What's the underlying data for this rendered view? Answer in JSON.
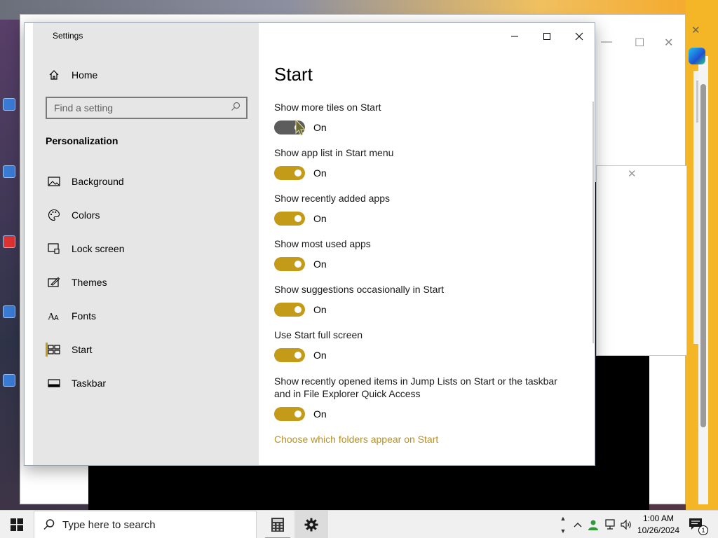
{
  "window": {
    "title": "Settings",
    "minimize_label": "Minimize",
    "maximize_label": "Maximize",
    "close_label": "Close"
  },
  "sidebar": {
    "home_label": "Home",
    "search_placeholder": "Find a setting",
    "section_heading": "Personalization",
    "items": [
      {
        "label": "Background",
        "icon": "picture-icon",
        "active": false
      },
      {
        "label": "Colors",
        "icon": "palette-icon",
        "active": false
      },
      {
        "label": "Lock screen",
        "icon": "lock-screen-icon",
        "active": false
      },
      {
        "label": "Themes",
        "icon": "themes-brush-icon",
        "active": false
      },
      {
        "label": "Fonts",
        "icon": "fonts-icon",
        "active": false
      },
      {
        "label": "Start",
        "icon": "start-tiles-icon",
        "active": true
      },
      {
        "label": "Taskbar",
        "icon": "taskbar-icon",
        "active": false
      }
    ]
  },
  "main": {
    "title": "Start",
    "settings": [
      {
        "label": "Show more tiles on Start",
        "state": "On"
      },
      {
        "label": "Show app list in Start menu",
        "state": "On"
      },
      {
        "label": "Show recently added apps",
        "state": "On"
      },
      {
        "label": "Show most used apps",
        "state": "On"
      },
      {
        "label": "Show suggestions occasionally in Start",
        "state": "On"
      },
      {
        "label": "Use Start full screen",
        "state": "On"
      },
      {
        "label": "Show recently opened items in Jump Lists on Start or the taskbar and in File Explorer Quick Access",
        "state": "On"
      }
    ],
    "link": "Choose which folders appear on Start"
  },
  "taskbar": {
    "search_placeholder": "Type here to search",
    "time": "1:00 AM",
    "date": "10/26/2024",
    "notification_count": "1"
  },
  "colors": {
    "accent": "#c49a19",
    "link": "#b89020",
    "sidebar_bg": "#e6e6e6"
  }
}
